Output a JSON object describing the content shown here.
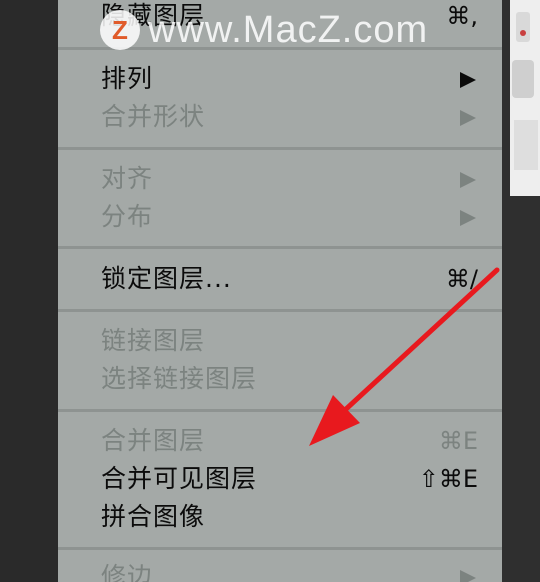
{
  "watermark": {
    "logo_letter": "Z",
    "text": "www.MacZ.com"
  },
  "menu": {
    "items": [
      {
        "label": "隐藏图层",
        "shortcut": "⌘,",
        "disabled": false
      },
      {
        "label": "排列",
        "submenu": true,
        "disabled": false
      },
      {
        "label": "合并形状",
        "submenu": true,
        "disabled": true
      },
      {
        "label": "对齐",
        "submenu": true,
        "disabled": true
      },
      {
        "label": "分布",
        "submenu": true,
        "disabled": true
      },
      {
        "label": "锁定图层...",
        "shortcut": "⌘/",
        "disabled": false
      },
      {
        "label": "链接图层",
        "disabled": true
      },
      {
        "label": "选择链接图层",
        "disabled": true
      },
      {
        "label": "合并图层",
        "shortcut": "⌘E",
        "disabled": true
      },
      {
        "label": "合并可见图层",
        "shortcut": "⇧⌘E",
        "disabled": false
      },
      {
        "label": "拼合图像",
        "disabled": false
      },
      {
        "label": "修边",
        "submenu": true,
        "disabled": true
      }
    ]
  },
  "annotation": {
    "color": "#e8191e",
    "icon": "red-arrow-annotation"
  }
}
